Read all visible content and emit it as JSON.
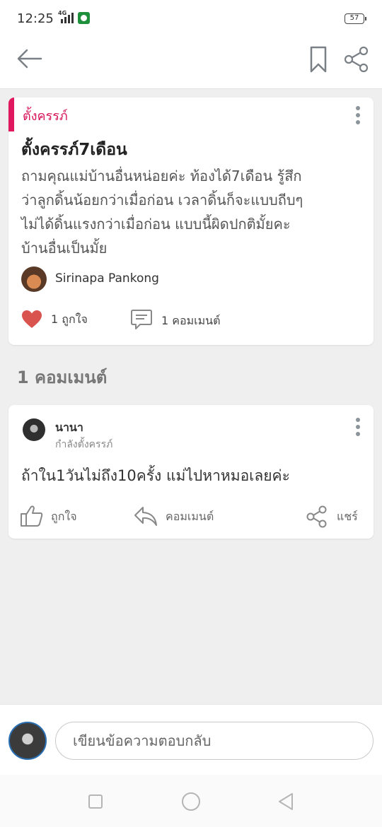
{
  "status_bar": {
    "time": "12:25",
    "network": "4G",
    "battery": "57"
  },
  "app_bar": {
    "back_icon": "arrow-left-icon",
    "bookmark_icon": "bookmark-icon",
    "share_icon": "share-icon"
  },
  "post": {
    "category": "ตั้งครรภ์",
    "title": "ตั้งครรภ์7เดือน",
    "body_lines": [
      "ถามคุณแม่บ้านอื่นหน่อยค่ะ ท้องได้7เดือน รู้สึก",
      "ว่าลูกดิ้นน้อยกว่าเมื่อก่อน เวลาดิ้นก็จะแบบถีบๆ",
      "ไม่ได้ดิ้นแรงกว่าเมื่อก่อน แบบนี้ผิดปกติมั้ยคะ",
      "บ้านอื่นเป็นมั้ย"
    ],
    "author": "Sirinapa Pankong",
    "likes": "1 ถูกใจ",
    "comments": "1 คอมเมนต์"
  },
  "comments_heading": "1 คอมเมนต์",
  "comment": {
    "name": "นานา",
    "subtitle": "กำลังตั้งครรภ์",
    "text": "ถ้าใน1วันไม่ถึง10ครั้ง แม่ไปหาหมอเลยค่ะ",
    "actions": {
      "like": "ถูกใจ",
      "reply": "คอมเมนต์",
      "share": "แชร์"
    }
  },
  "reply": {
    "placeholder": "เขียนข้อความตอบกลับ"
  },
  "colors": {
    "accent": "#e0195e",
    "heart": "#d9534f"
  }
}
